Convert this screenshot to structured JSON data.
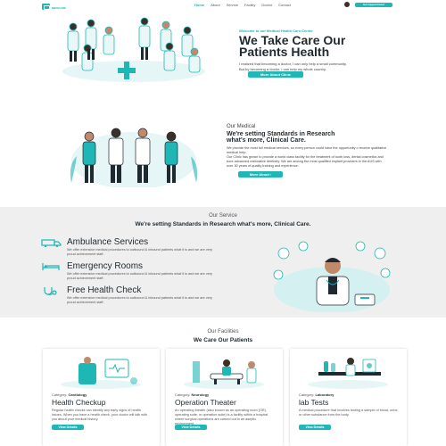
{
  "nav": {
    "logo_text": "MEDICARE",
    "menu": [
      "Home",
      "About",
      "Service",
      "Facility",
      "Doctor",
      "Contact"
    ],
    "cta": "Get Appointment"
  },
  "hero": {
    "kicker": "Welcome to our Medical Health Care Center",
    "title_line1": "We Take Care Our",
    "title_line2": "Patients Health",
    "sub1": "I realized that becoming a doctor, I can only help a small community.",
    "sub2": "But by becoming a doctor, I can help my whole country.",
    "button": "More About Clinic"
  },
  "about": {
    "kicker": "Our Medical",
    "title_line1": "We're setting Standards in Research",
    "title_line2": "what's more, Clinical Care.",
    "body1": "We provide the most full medical services, so every person could have the opportunity o receive qualitative medical help.",
    "body2": "Our Clinic has grown to provide a world class facility for the treatment of tooth loss, dental cosmetics and bore advanced restorative dentistry. We are among the most qualified implant providers in the AUS with over 30 years of quality training and experience.",
    "button": "More About"
  },
  "service": {
    "kicker": "Our Service",
    "title": "We're setting Standards in Research what's more, Clinical Care.",
    "items": [
      {
        "name": "Ambulance Services",
        "desc": "We offer extensive medical procedures to outbound & inbound patients what it is and we are very proud achievement staff."
      },
      {
        "name": "Emergency Rooms",
        "desc": "We offer extensive medical procedures to outbound & inbound patients what it is and we are very proud achievement staff."
      },
      {
        "name": "Free Health Check",
        "desc": "We offer extensive medical procedures to outbound & inbound patients what it is and we are very proud achievement staff."
      }
    ]
  },
  "facilities": {
    "kicker": "Our Facilities",
    "title": "We Care Our Patients",
    "cards": [
      {
        "category_label": "Category:",
        "category": "Cardiology",
        "name": "Health Checkup",
        "desc": "Regular health checks can identify any early signs of health issues. When you have a health check, your doctor will talk with you about your medical history.",
        "button": "View Details"
      },
      {
        "category_label": "Category:",
        "category": "Neurology",
        "name": "Operation Theater",
        "desc": "An operating theater (also known as an operating room (OR), operating suite, or operation suite) is a facility within a hospital where surgical operations are carried out in an aseptic environment.",
        "button": "View Details"
      },
      {
        "category_label": "Category:",
        "category": "Laboratory",
        "name": "lab Tests",
        "desc": "A medical procedure that involves testing a sample of blood, urine, or other substance from the body.",
        "button": "View Details"
      }
    ]
  },
  "colors": {
    "accent": "#1fb6b6",
    "dark": "#1f2a30",
    "band": "#efefef"
  }
}
